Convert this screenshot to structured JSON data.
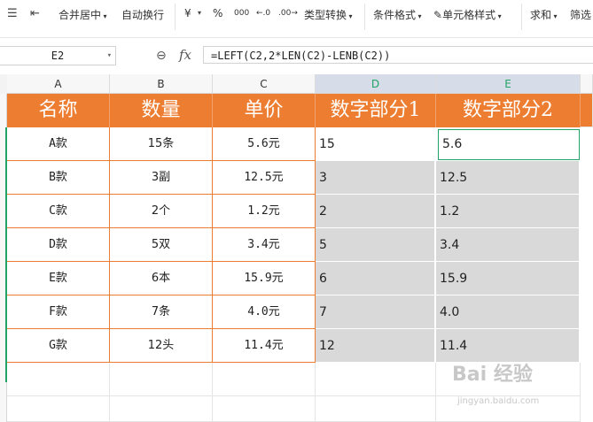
{
  "toolbar": {
    "merge_label": "合并居中",
    "wrap_label": "自动换行",
    "currency_symbol": "¥",
    "percent_symbol": "%",
    "thousands_symbol": "000",
    "dec_increase_symbol": "←.0",
    "dec_decrease_symbol": ".00→",
    "type_convert_label": "类型转换",
    "cond_format_label": "条件格式",
    "cell_style_label": "单元格样式",
    "sum_label": "求和",
    "filter_label": "筛选"
  },
  "formula_bar": {
    "cell_ref": "E2",
    "fx_label": "fx",
    "formula": "=LEFT(C2,2*LEN(C2)-LENB(C2))"
  },
  "columns": [
    "A",
    "B",
    "C",
    "D",
    "E"
  ],
  "header_row": [
    "名称",
    "数量",
    "单价",
    "数字部分1",
    "数字部分2"
  ],
  "rows": [
    {
      "name": "A款",
      "qty": "15条",
      "price": "5.6元",
      "num1": "15",
      "num2": "5.6"
    },
    {
      "name": "B款",
      "qty": "3副",
      "price": "12.5元",
      "num1": "3",
      "num2": "12.5"
    },
    {
      "name": "C款",
      "qty": "2个",
      "price": "1.2元",
      "num1": "2",
      "num2": "1.2"
    },
    {
      "name": "D款",
      "qty": "5双",
      "price": "3.4元",
      "num1": "5",
      "num2": "3.4"
    },
    {
      "name": "E款",
      "qty": "6本",
      "price": "15.9元",
      "num1": "6",
      "num2": "15.9"
    },
    {
      "name": "F款",
      "qty": "7条",
      "price": "4.0元",
      "num1": "7",
      "num2": "4.0"
    },
    {
      "name": "G款",
      "qty": "12头",
      "price": "11.4元",
      "num1": "12",
      "num2": "11.4"
    }
  ],
  "watermark": {
    "text": "Bai 经验",
    "sub": "jingyan.baidu.com"
  },
  "colors": {
    "header_fill": "#ed7d31",
    "selection": "#21a366",
    "result_fill": "#d9d9d9"
  }
}
